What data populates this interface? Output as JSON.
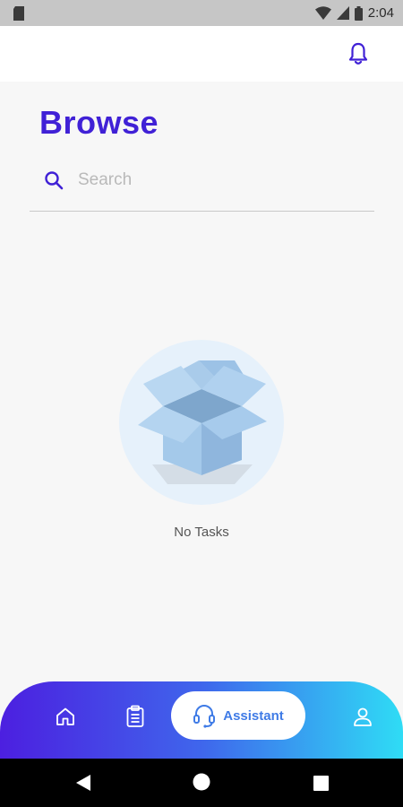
{
  "status_bar": {
    "time": "2:04"
  },
  "header": {
    "bell_icon": "bell-icon"
  },
  "page": {
    "title": "Browse"
  },
  "search": {
    "placeholder": "Search",
    "value": ""
  },
  "empty_state": {
    "message": "No Tasks",
    "icon": "open-box-icon"
  },
  "bottom_nav": {
    "items": [
      {
        "icon": "home-icon"
      },
      {
        "icon": "clipboard-icon"
      },
      {
        "icon": "headset-icon",
        "label": "Assistant",
        "active": true
      },
      {
        "icon": "user-icon"
      }
    ]
  },
  "colors": {
    "accent": "#4021d6",
    "assistant_label": "#3f7be6",
    "gradient_start": "#4c1fe0",
    "gradient_end": "#2fdcf5"
  }
}
